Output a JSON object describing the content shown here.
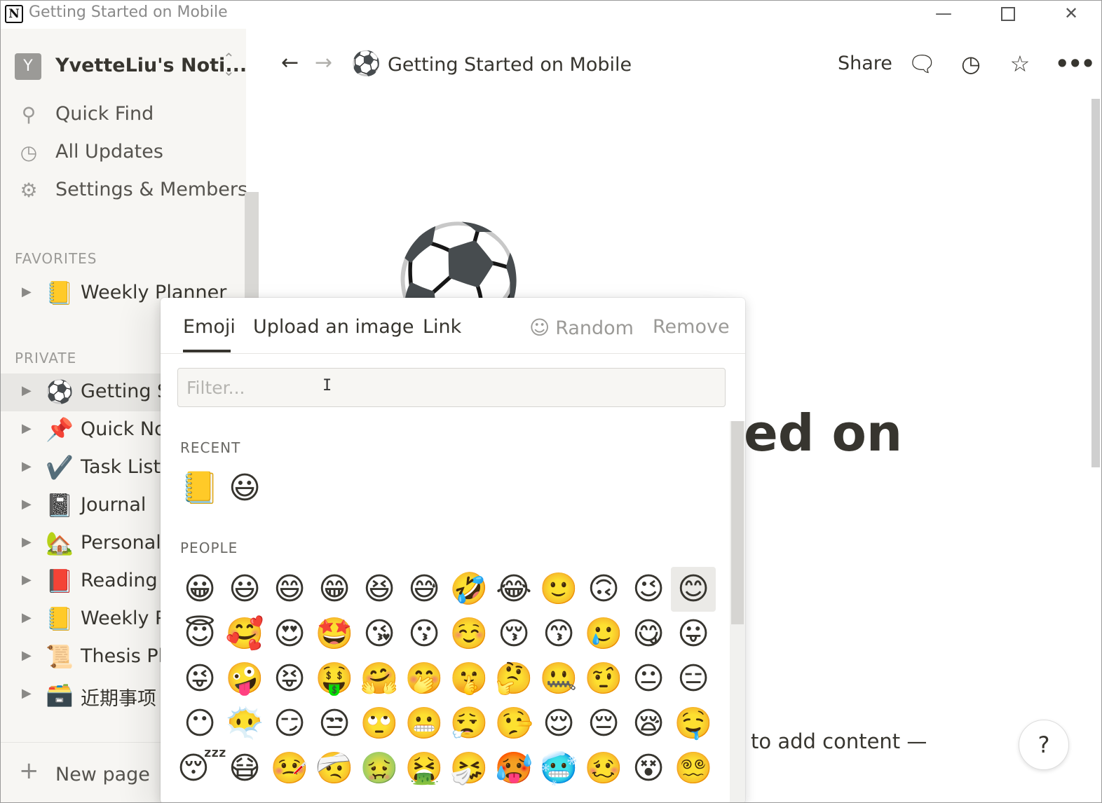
{
  "window": {
    "title": "Getting Started on Mobile",
    "logo_letter": "N",
    "minimize": "—",
    "close": "✕"
  },
  "workspace": {
    "avatar": "Y",
    "name": "YvetteLiu's Noti...",
    "switch_icon": "⌃⌄"
  },
  "sidebar": {
    "links": [
      {
        "icon": "search-icon",
        "glyph": "⚲",
        "label": "Quick Find"
      },
      {
        "icon": "clock-icon",
        "glyph": "◷",
        "label": "All Updates"
      },
      {
        "icon": "gear-icon",
        "glyph": "⚙",
        "label": "Settings & Members"
      }
    ],
    "favorites_label": "FAVORITES",
    "favorites": [
      {
        "emoji": "📒",
        "label": "Weekly Planner"
      }
    ],
    "private_label": "PRIVATE",
    "private": [
      {
        "emoji": "⚽",
        "label": "Getting S",
        "active": true
      },
      {
        "emoji": "📌",
        "label": "Quick No"
      },
      {
        "emoji": "✔️",
        "label": "Task List"
      },
      {
        "emoji": "📓",
        "label": "Journal"
      },
      {
        "emoji": "🏡",
        "label": "Personal"
      },
      {
        "emoji": "📕",
        "label": "Reading"
      },
      {
        "emoji": "📒",
        "label": "Weekly P"
      },
      {
        "emoji": "📜",
        "label": "Thesis Pla"
      },
      {
        "emoji": "🗃️",
        "label": "近期事项"
      }
    ],
    "arrow": "▶",
    "new_page": {
      "icon": "+",
      "label": "New page"
    }
  },
  "topbar": {
    "back": "←",
    "forward": "→",
    "page_emoji": "⚽",
    "page_title": "Getting Started on Mobile",
    "share": "Share",
    "comment_icon": "🗨",
    "history_icon": "◷",
    "star_icon": "☆",
    "more_icon": "•••"
  },
  "page": {
    "cover_emoji": "⚽",
    "heading_fragment": "ed on",
    "hint_fragment": "to add content —",
    "help": "?"
  },
  "picker": {
    "tabs": {
      "emoji": "Emoji",
      "upload": "Upload an image",
      "link": "Link",
      "random_icon": "☺",
      "random": "Random",
      "remove": "Remove"
    },
    "filter_placeholder": "Filter...",
    "cursor": "I",
    "recent_label": "RECENT",
    "recent": [
      "📒",
      "😃"
    ],
    "people_label": "PEOPLE",
    "people": [
      "😀",
      "😃",
      "😄",
      "😁",
      "😆",
      "😅",
      "🤣",
      "😂",
      "🙂",
      "🙃",
      "😉",
      "😊",
      "😇",
      "🥰",
      "😍",
      "🤩",
      "😘",
      "😗",
      "☺️",
      "😚",
      "😙",
      "🥲",
      "😋",
      "😛",
      "😜",
      "🤪",
      "😝",
      "🤑",
      "🤗",
      "🤭",
      "🤫",
      "🤔",
      "🤐",
      "🤨",
      "😐",
      "😑",
      "😶",
      "😶‍🌫️",
      "😏",
      "😒",
      "🙄",
      "😬",
      "😮‍💨",
      "🤥",
      "😌",
      "😔",
      "😪",
      "🤤",
      "😴",
      "😷",
      "🤒",
      "🤕",
      "🤢",
      "🤮",
      "🤧",
      "🥵",
      "🥶",
      "🥴",
      "😵",
      "😵‍💫"
    ],
    "hover_index": 11
  }
}
